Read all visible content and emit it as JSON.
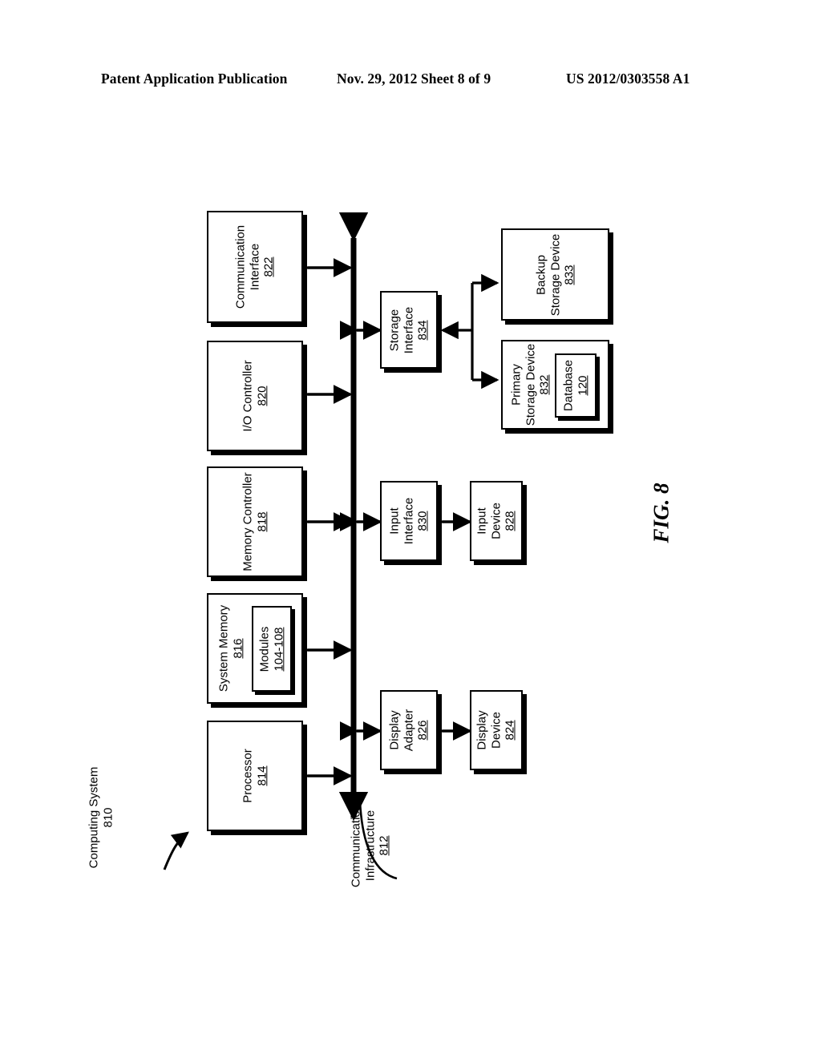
{
  "header": {
    "publication": "Patent Application Publication",
    "date_sheet": "Nov. 29, 2012  Sheet 8 of 9",
    "patent_number": "US 2012/0303558 A1"
  },
  "figure": {
    "label": "FIG. 8",
    "system_caption": {
      "title": "Computing System",
      "number": "810"
    },
    "bus_caption": {
      "line1": "Communication",
      "line2": "Infrastructure",
      "number": "812"
    }
  },
  "blocks": {
    "communication_interface": {
      "line1": "Communication",
      "line2": "Interface",
      "number": "822"
    },
    "io_controller": {
      "line1": "I/O Controller",
      "number": "820"
    },
    "memory_controller": {
      "line1": "Memory Controller",
      "number": "818"
    },
    "system_memory": {
      "line1": "System Memory",
      "number": "816"
    },
    "modules": {
      "line1": "Modules",
      "number": "104-108"
    },
    "processor": {
      "line1": "Processor",
      "number": "814"
    },
    "storage_interface": {
      "line1": "Storage",
      "line2": "Interface",
      "number": "834"
    },
    "backup_storage_device": {
      "line1": "Backup",
      "line2": "Storage Device",
      "number": "833"
    },
    "primary_storage_device": {
      "line1": "Primary",
      "line2": "Storage Device",
      "number": "832"
    },
    "database": {
      "line1": "Database",
      "number": "120"
    },
    "input_interface": {
      "line1": "Input",
      "line2": "Interface",
      "number": "830"
    },
    "input_device": {
      "line1": "Input",
      "line2": "Device",
      "number": "828"
    },
    "display_adapter": {
      "line1": "Display",
      "line2": "Adapter",
      "number": "826"
    },
    "display_device": {
      "line1": "Display",
      "line2": "Device",
      "number": "824"
    }
  },
  "colors": {
    "ink": "#000000",
    "paper": "#ffffff"
  }
}
